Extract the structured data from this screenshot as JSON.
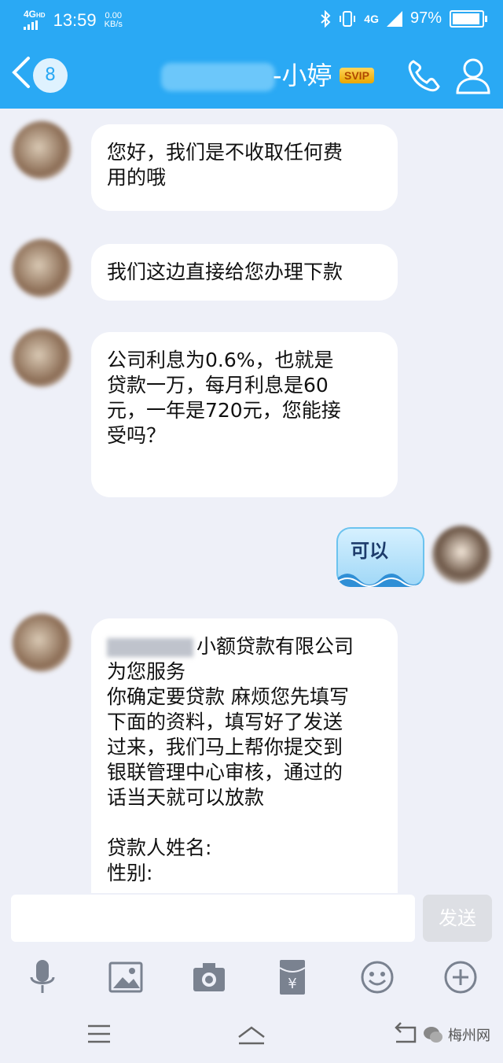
{
  "status_bar": {
    "network": "4G",
    "network_suffix": "HD",
    "time": "13:59",
    "speed_value": "0.00",
    "speed_unit": "KB/s",
    "right_network": "4G",
    "battery": "97%"
  },
  "header": {
    "unread_count": "8",
    "contact_name_suffix": "-小婷",
    "badge": "SVIP",
    "icons": [
      "back-arrow-icon",
      "phone-icon",
      "profile-icon"
    ]
  },
  "messages": [
    {
      "side": "left",
      "text": "您好，我们是不收取任何费\n用的哦"
    },
    {
      "side": "left",
      "text": "我们这边直接给您办理下款"
    },
    {
      "side": "left",
      "text": "公司利息为0.6%，也就是\n贷款一万，每月利息是60\n元，一年是720元，您能接\n受吗？"
    },
    {
      "side": "right",
      "sticker_text": "可以"
    },
    {
      "side": "left",
      "company_suffix": "小额贷款有限公司",
      "text": "为您服务\n你确定要贷款 麻烦您先填写\n下面的资料，填写好了发送\n过来，我们马上帮你提交到\n银联管理中心审核，通过的\n话当天就可以放款\n\n贷款人姓名:\n性别:"
    }
  ],
  "input_bar": {
    "placeholder": "",
    "send_label": "发送"
  },
  "toolbar": {
    "icons": [
      "microphone-icon",
      "image-icon",
      "camera-icon",
      "red-packet-icon",
      "emoji-icon",
      "plus-icon"
    ]
  },
  "nav": {
    "icons": [
      "menu-icon",
      "home-icon",
      "back-icon"
    ],
    "watermark": "梅州网"
  },
  "colors": {
    "header_bg": "#2aa9f4",
    "chat_bg": "#eef0f8",
    "bubble_bg": "#ffffff",
    "svip_gold": "#e8a600"
  }
}
